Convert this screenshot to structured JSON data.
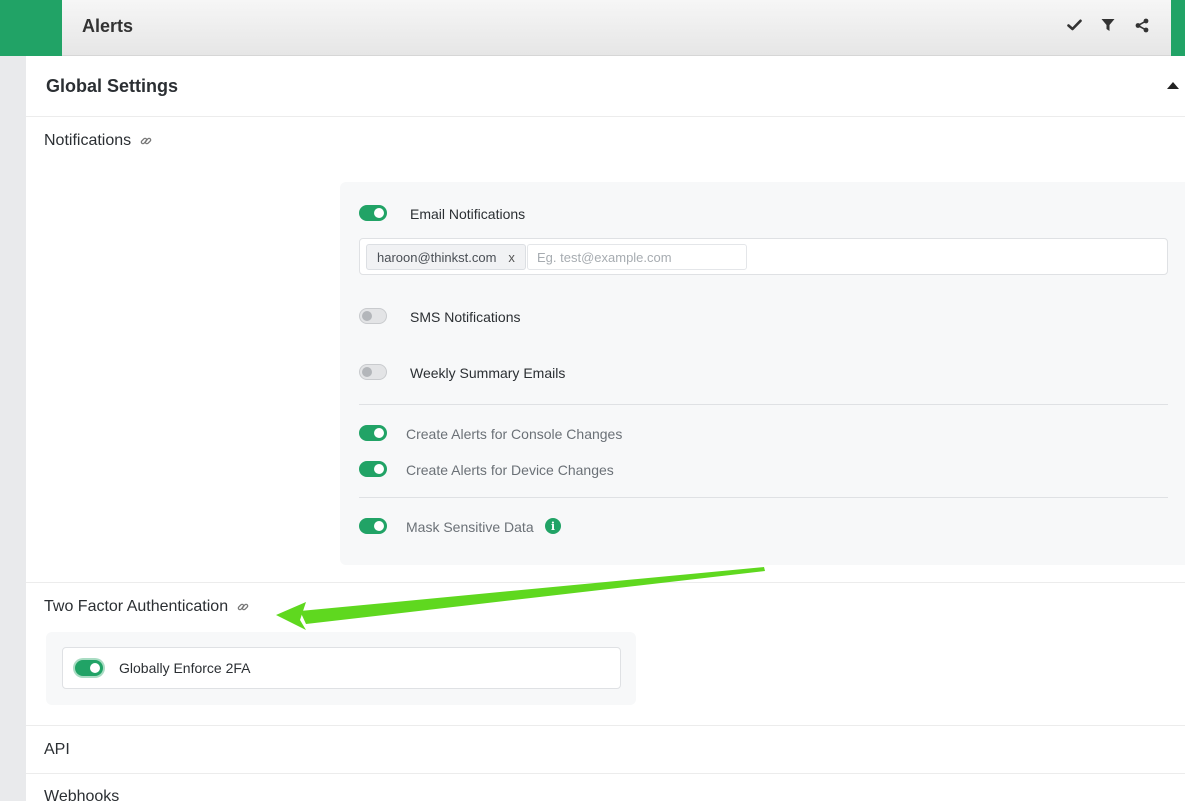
{
  "topbar": {
    "title": "Alerts",
    "icons": [
      "check-icon",
      "filter-icon",
      "share-icon"
    ]
  },
  "panel": {
    "title": "Global Settings"
  },
  "notifications": {
    "section_label": "Notifications",
    "email": {
      "label": "Email Notifications",
      "enabled": true,
      "recipients": [
        "haroon@thinkst.com"
      ],
      "remove_label": "x",
      "placeholder": "Eg. test@example.com"
    },
    "sms": {
      "label": "SMS Notifications",
      "enabled": false
    },
    "weekly": {
      "label": "Weekly Summary Emails",
      "enabled": false
    },
    "console_changes": {
      "label": "Create Alerts for Console Changes",
      "enabled": true
    },
    "device_changes": {
      "label": "Create Alerts for Device Changes",
      "enabled": true
    },
    "mask_sensitive": {
      "label": "Mask Sensitive Data",
      "enabled": true,
      "info_glyph": "i"
    }
  },
  "two_factor": {
    "section_label": "Two Factor Authentication",
    "enforce": {
      "label": "Globally Enforce 2FA",
      "enabled": true
    }
  },
  "sections": {
    "api": "API",
    "webhooks": "Webhooks"
  },
  "colors": {
    "accent": "#21a366",
    "annotation_arrow": "#5fd81f"
  }
}
